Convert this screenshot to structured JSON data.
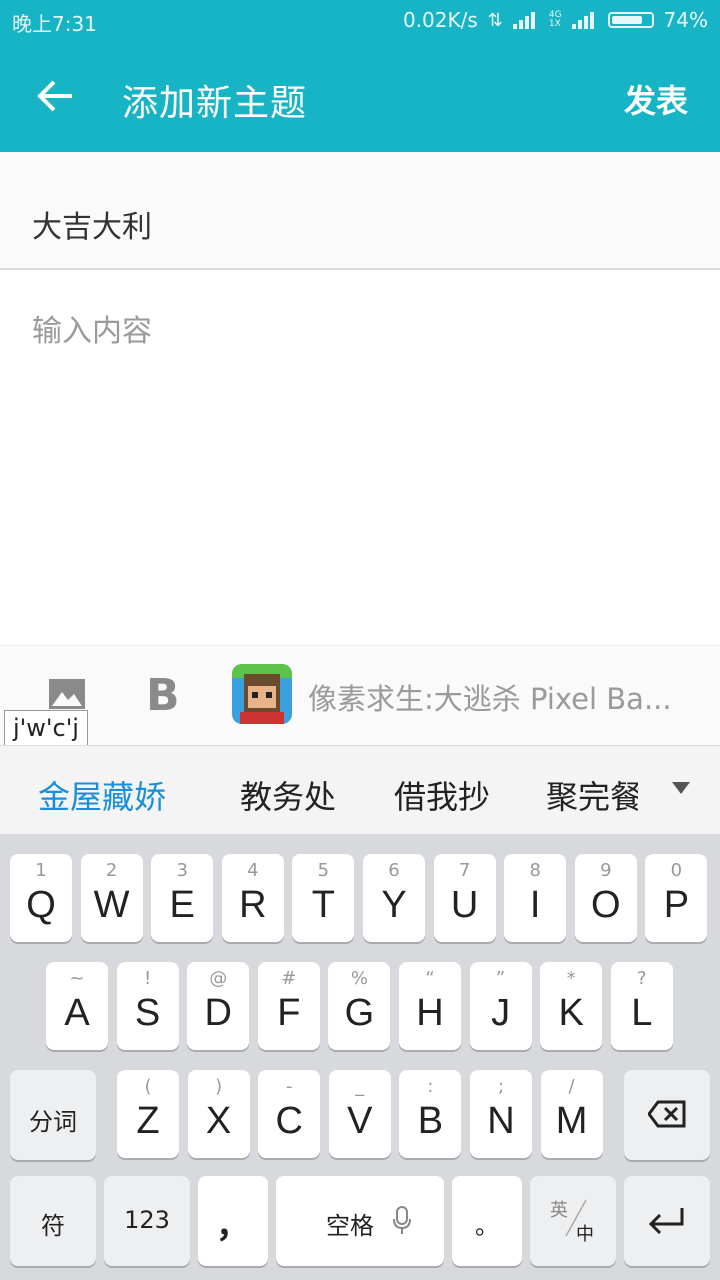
{
  "status_bar": {
    "time": "晚上7:31",
    "speed": "0.02K/s",
    "network": "4G",
    "network2": "1X",
    "battery": "74%"
  },
  "app_bar": {
    "title": "添加新主题",
    "publish": "发表"
  },
  "subject": {
    "value": "大吉大利"
  },
  "content": {
    "placeholder": "输入内容"
  },
  "toolbar": {
    "bold": "B",
    "ad_text": "像素求生:大逃杀  Pixel Ba..."
  },
  "composition": "j'w'c'j",
  "candidates": [
    "金屋藏娇",
    "教务处",
    "借我抄",
    "聚完餐"
  ],
  "keyboard": {
    "row1": [
      {
        "ch": "Q",
        "hint": "1"
      },
      {
        "ch": "W",
        "hint": "2"
      },
      {
        "ch": "E",
        "hint": "3"
      },
      {
        "ch": "R",
        "hint": "4"
      },
      {
        "ch": "T",
        "hint": "5"
      },
      {
        "ch": "Y",
        "hint": "6"
      },
      {
        "ch": "U",
        "hint": "7"
      },
      {
        "ch": "I",
        "hint": "8"
      },
      {
        "ch": "O",
        "hint": "9"
      },
      {
        "ch": "P",
        "hint": "0"
      }
    ],
    "row2": [
      {
        "ch": "A",
        "hint": "~"
      },
      {
        "ch": "S",
        "hint": "!"
      },
      {
        "ch": "D",
        "hint": "@"
      },
      {
        "ch": "F",
        "hint": "#"
      },
      {
        "ch": "G",
        "hint": "%"
      },
      {
        "ch": "H",
        "hint": "“"
      },
      {
        "ch": "J",
        "hint": "”"
      },
      {
        "ch": "K",
        "hint": "*"
      },
      {
        "ch": "L",
        "hint": "?"
      }
    ],
    "row3": [
      {
        "ch": "Z",
        "hint": "("
      },
      {
        "ch": "X",
        "hint": ")"
      },
      {
        "ch": "C",
        "hint": "-"
      },
      {
        "ch": "V",
        "hint": "_"
      },
      {
        "ch": "B",
        "hint": ":"
      },
      {
        "ch": "N",
        "hint": ";"
      },
      {
        "ch": "M",
        "hint": "/"
      }
    ],
    "fenci": "分词",
    "fu": "符",
    "num": "123",
    "comma": "，",
    "space": "空格",
    "period": "。",
    "lang_top": "英",
    "lang_bottom": "中"
  }
}
